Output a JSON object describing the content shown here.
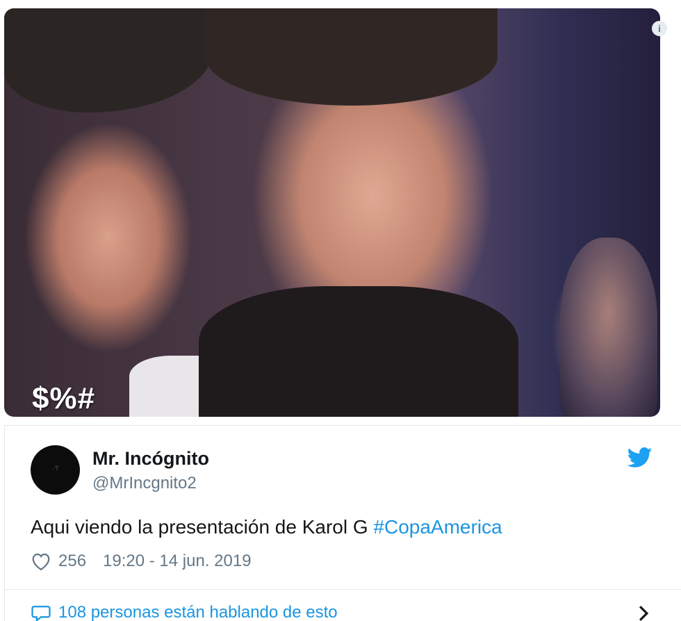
{
  "media": {
    "overlay_text": "$%#",
    "info_icon": "info-icon"
  },
  "tweet": {
    "author": {
      "display_name": "Mr. Incógnito",
      "handle": "@MrIncgnito2",
      "avatar_icon": "avatar"
    },
    "text_main": "Aqui viendo la presentación de Karol G ",
    "hashtag": "#CopaAmerica",
    "likes": "256",
    "timestamp": "19:20 - 14 jun. 2019",
    "brand_icon": "twitter-bird-icon"
  },
  "conversation": {
    "label": "108 personas están hablando de esto"
  },
  "colors": {
    "link": "#1b95e0",
    "muted": "#657786",
    "text": "#14171a",
    "border": "#e1e8ed"
  }
}
